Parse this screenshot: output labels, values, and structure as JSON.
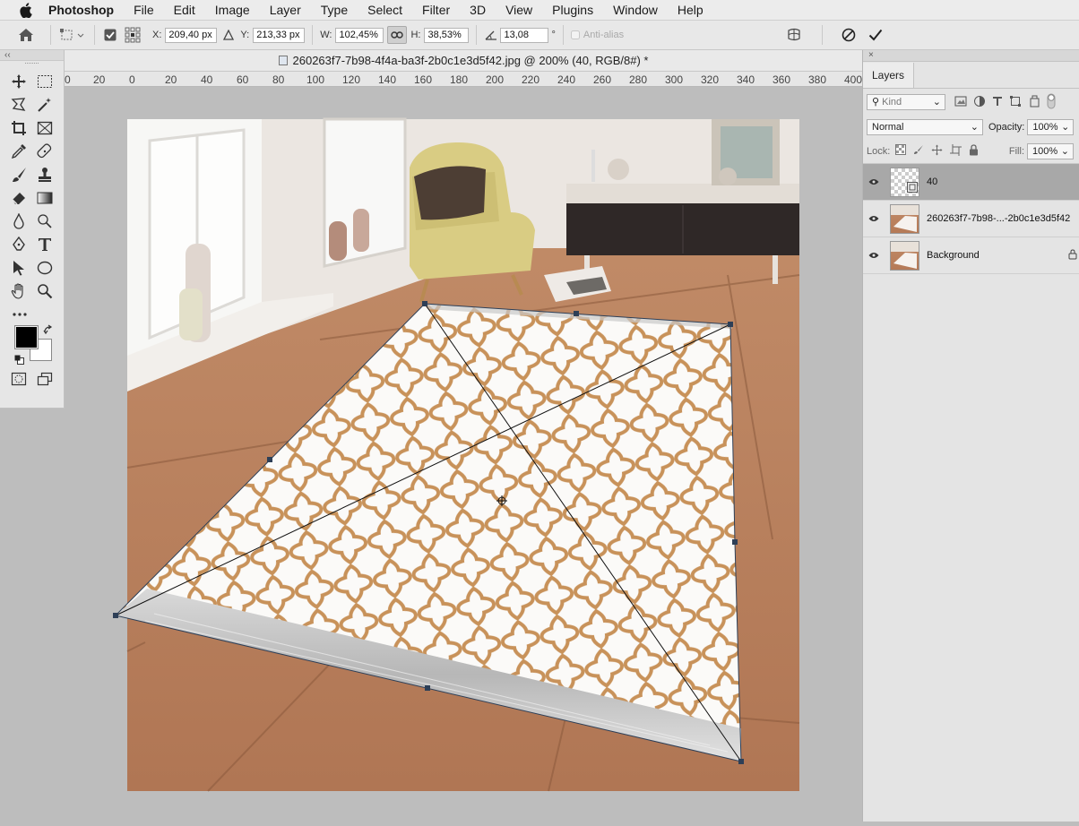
{
  "menubar": {
    "app_name": "Photoshop",
    "items": [
      "File",
      "Edit",
      "Image",
      "Layer",
      "Type",
      "Select",
      "Filter",
      "3D",
      "View",
      "Plugins",
      "Window",
      "Help"
    ]
  },
  "options": {
    "x_label": "X:",
    "x_value": "209,40 px",
    "y_label": "Y:",
    "y_value": "213,33 px",
    "w_label": "W:",
    "w_value": "102,45%",
    "h_label": "H:",
    "h_value": "38,53%",
    "angle_value": "13,08",
    "angle_unit": "°",
    "antialias_label": "Anti-alias"
  },
  "document": {
    "title": "260263f7-7b98-4f4a-ba3f-2b0c1e3d5f42.jpg @ 200% (40, RGB/8#) *"
  },
  "ruler": {
    "labels": [
      "0",
      "20",
      "0",
      "20",
      "40",
      "60",
      "80",
      "100",
      "120",
      "140",
      "160",
      "180",
      "200",
      "220",
      "240",
      "260",
      "280",
      "300",
      "320",
      "340",
      "360",
      "380",
      "400"
    ]
  },
  "toolbar": {
    "collapse": "‹‹"
  },
  "layers_panel": {
    "close": "×",
    "tab_label": "Layers",
    "filter_placeholder": "Kind",
    "blend_mode": "Normal",
    "opacity_label": "Opacity:",
    "opacity_value": "100%",
    "lock_label": "Lock:",
    "fill_label": "Fill:",
    "fill_value": "100%",
    "layers": [
      {
        "name": "40",
        "selected": true
      },
      {
        "name": "260263f7-7b98-...-2b0c1e3d5f42",
        "selected": false
      },
      {
        "name": "Background",
        "selected": false
      }
    ]
  },
  "colors": {
    "rug_pattern": "#c8925a",
    "floor": "#b9835e",
    "wall": "#ece7e2",
    "chair": "#d9cc83",
    "cabinet": "#2f2827"
  }
}
